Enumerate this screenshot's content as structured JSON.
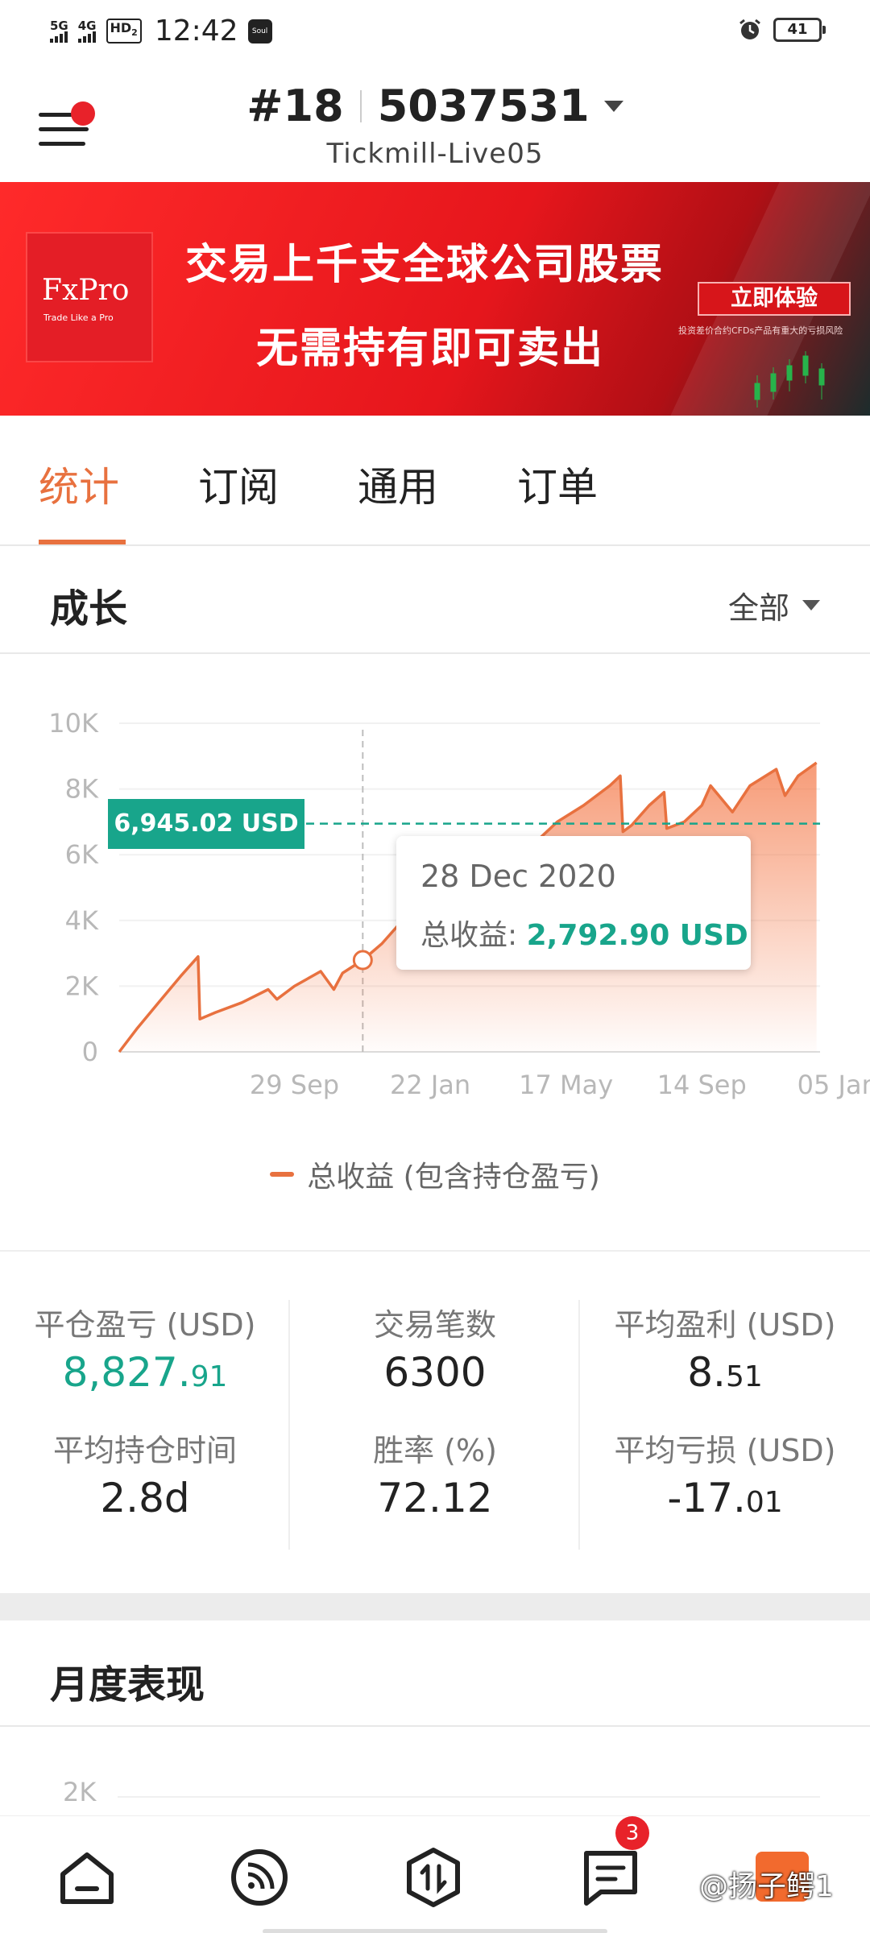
{
  "status_bar": {
    "network_1": "5G",
    "network_2": "4G",
    "hd": "HD",
    "hd_sub": "2",
    "time": "12:42",
    "app_icon": "Soul",
    "battery": "41"
  },
  "header": {
    "account_prefix": "#18",
    "account_number": "5037531",
    "server": "Tickmill-Live05",
    "icons": [
      "menu-icon",
      "notification-dot",
      "dropdown-caret-icon"
    ]
  },
  "banner": {
    "logo": "FxPro",
    "logo_tagline": "Trade Like a Pro",
    "headline": "交易上千支全球公司股票",
    "subheadline": "无需持有即可卖出",
    "cta": "立即体验",
    "disclaimer": "投资差价合约CFDs产品有重大的亏损风险"
  },
  "tabs": [
    {
      "label": "统计",
      "active": true
    },
    {
      "label": "订阅",
      "active": false
    },
    {
      "label": "通用",
      "active": false
    },
    {
      "label": "订单",
      "active": false
    }
  ],
  "growth": {
    "title": "成长",
    "range": "全部"
  },
  "chart_data": {
    "type": "area",
    "title": "",
    "y_tick_labels": [
      "0",
      "2K",
      "4K",
      "6K",
      "8K",
      "10K"
    ],
    "x_tick_labels": [
      "29 Sep",
      "22 Jan",
      "17 May",
      "14 Sep",
      "05 Jan"
    ],
    "ylim": [
      0,
      10000
    ],
    "grid": true,
    "legend_placement": "bottom-center",
    "series": [
      {
        "name": "总收益 (包含持仓盈亏)",
        "color": "#e8713f",
        "points": [
          [
            0,
            0
          ],
          [
            0.2,
            700
          ],
          [
            0.45,
            1500
          ],
          [
            0.7,
            2300
          ],
          [
            0.9,
            2900
          ],
          [
            0.92,
            1000
          ],
          [
            1.1,
            1200
          ],
          [
            1.4,
            1500
          ],
          [
            1.7,
            1900
          ],
          [
            1.8,
            1600
          ],
          [
            2.0,
            2000
          ],
          [
            2.3,
            2450
          ],
          [
            2.45,
            1900
          ],
          [
            2.55,
            2400
          ],
          [
            2.78,
            2792.9
          ],
          [
            3.0,
            3300
          ],
          [
            3.2,
            3900
          ],
          [
            3.6,
            4600
          ],
          [
            4.0,
            5200
          ],
          [
            4.4,
            5800
          ],
          [
            4.8,
            6500
          ],
          [
            5.0,
            7000
          ],
          [
            5.3,
            7500
          ],
          [
            5.6,
            8100
          ],
          [
            5.72,
            8400
          ],
          [
            5.75,
            6700
          ],
          [
            5.85,
            6900
          ],
          [
            6.05,
            7500
          ],
          [
            6.22,
            7900
          ],
          [
            6.25,
            6800
          ],
          [
            6.45,
            7000
          ],
          [
            6.65,
            7500
          ],
          [
            6.75,
            8100
          ],
          [
            7.0,
            7300
          ],
          [
            7.2,
            8100
          ],
          [
            7.5,
            8600
          ],
          [
            7.6,
            7800
          ],
          [
            7.75,
            8400
          ],
          [
            7.96,
            8800
          ]
        ]
      }
    ],
    "reference_line": {
      "label": "6,945.02 USD",
      "value": 6945.02,
      "color": "#18a58b"
    },
    "tooltip": {
      "date": "28 Dec 2020",
      "label": "总收益:",
      "value": "2,792.90 USD"
    }
  },
  "stats": {
    "closed_pl": {
      "label": "平仓盈亏 (USD)",
      "int": "8,827.",
      "dec": "91"
    },
    "trades": {
      "label": "交易笔数",
      "value": "6300"
    },
    "avg_profit": {
      "label": "平均盈利 (USD)",
      "int": "8.",
      "dec": "51"
    },
    "avg_hold": {
      "label": "平均持仓时间",
      "value": "2.8d"
    },
    "win_rate": {
      "label": "胜率 (%)",
      "value": "72.12"
    },
    "avg_loss": {
      "label": "平均亏损 (USD)",
      "int": "-17.",
      "dec": "01"
    }
  },
  "monthly": {
    "title": "月度表现",
    "first_tick": "2K"
  },
  "bottom_nav": {
    "items": [
      "home-icon",
      "feed-icon",
      "trade-icon",
      "messages-icon",
      "profile-icon"
    ],
    "messages_badge": "3",
    "watermark": "@扬子鳄1"
  }
}
